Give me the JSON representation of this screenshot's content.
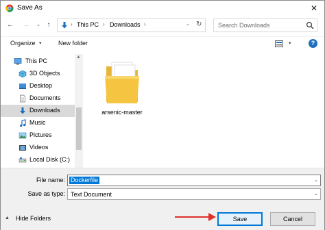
{
  "window": {
    "title": "Save As",
    "close_glyph": "✕"
  },
  "nav": {
    "back_glyph": "←",
    "forward_glyph": "→",
    "recent_glyph": "⌄",
    "up_glyph": "↑"
  },
  "address": {
    "crumbs": [
      "This PC",
      "Downloads"
    ],
    "sep_glyph": "›",
    "dropdown_glyph": "⌄",
    "refresh_glyph": "↻"
  },
  "search": {
    "placeholder": "Search Downloads"
  },
  "commands": {
    "organize": "Organize",
    "organize_arrow": "▾",
    "new_folder": "New folder",
    "view_arrow": "▾",
    "help": "?"
  },
  "sidebar": {
    "items": [
      {
        "label": "This PC",
        "icon": "computer-icon"
      },
      {
        "label": "3D Objects",
        "icon": "cube-icon"
      },
      {
        "label": "Desktop",
        "icon": "desktop-icon"
      },
      {
        "label": "Documents",
        "icon": "documents-icon"
      },
      {
        "label": "Downloads",
        "icon": "download-icon",
        "selected": true
      },
      {
        "label": "Music",
        "icon": "music-icon"
      },
      {
        "label": "Pictures",
        "icon": "pictures-icon"
      },
      {
        "label": "Videos",
        "icon": "videos-icon"
      },
      {
        "label": "Local Disk (C:)",
        "icon": "drive-icon"
      }
    ],
    "scroll_up_glyph": "▲"
  },
  "files": [
    {
      "name": "arsenic-master",
      "icon": "folder-icon"
    }
  ],
  "form": {
    "file_name_label": "File name:",
    "file_name_value": "Dockerfile",
    "save_type_label": "Save as type:",
    "save_type_value": "Text Document",
    "dropdown_glyph": "⌄"
  },
  "footer": {
    "hide_folders_glyph": "▲",
    "hide_folders": "Hide Folders",
    "save": "Save",
    "cancel": "Cancel"
  },
  "colors": {
    "accent": "#0078d7",
    "selection": "#d9d9d9",
    "annotation_arrow": "#e0302a",
    "folder": "#f5c542"
  }
}
